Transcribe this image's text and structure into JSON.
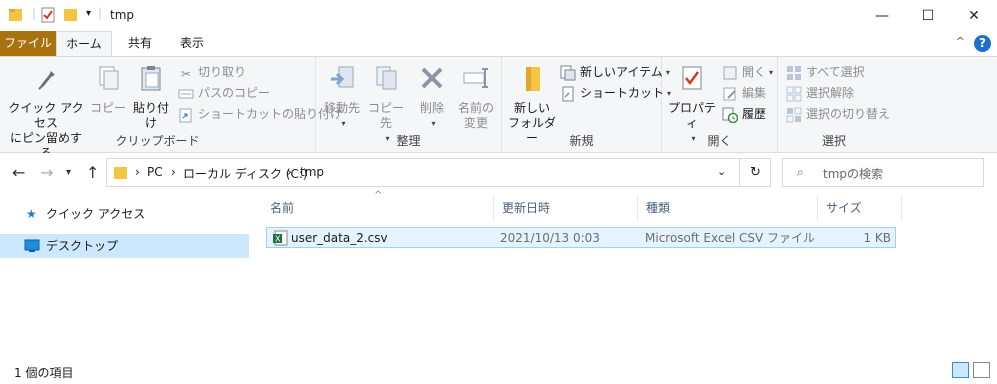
{
  "window": {
    "title": "tmp",
    "controls": {
      "minimize": "—",
      "maximize": "☐",
      "close": "✕"
    }
  },
  "ribbon_tabs": [
    {
      "label": "ファイル"
    },
    {
      "label": "ホーム"
    },
    {
      "label": "共有"
    },
    {
      "label": "表示"
    }
  ],
  "ribbon": {
    "clipboard": {
      "pin_label_1": "クイック アクセス",
      "pin_label_2": "にピン留めする",
      "copy_label": "コピー",
      "paste_label": "貼り付け",
      "cut_label": "切り取り",
      "copy_path_label": "パスのコピー",
      "paste_shortcut_label": "ショートカットの貼り付け",
      "group_label": "クリップボード"
    },
    "organize": {
      "move_to_label": "移動先",
      "copy_to_label": "コピー先",
      "delete_label": "削除",
      "rename_label_1": "名前の",
      "rename_label_2": "変更",
      "group_label": "整理"
    },
    "new": {
      "new_folder_label_1": "新しい",
      "new_folder_label_2": "フォルダー",
      "new_item_label": "新しいアイテム",
      "easy_access_label": "ショートカット",
      "group_label": "新規"
    },
    "open": {
      "properties_label": "プロパティ",
      "open_label": "開く",
      "edit_label": "編集",
      "history_label": "履歴",
      "group_label": "開く"
    },
    "select": {
      "select_all_label": "すべて選択",
      "select_none_label": "選択解除",
      "invert_label": "選択の切り替え",
      "group_label": "選択"
    }
  },
  "address": {
    "crumbs": [
      "PC",
      "ローカル ディスク (C:)",
      "tmp"
    ],
    "search_placeholder": "tmpの検索"
  },
  "nav_pane": [
    {
      "label": "クイック アクセス",
      "selected": false
    },
    {
      "label": "デスクトップ",
      "selected": true
    }
  ],
  "columns": [
    "名前",
    "更新日時",
    "種類",
    "サイズ"
  ],
  "files": [
    {
      "name": "user_data_2.csv",
      "modified": "2021/10/13 0:03",
      "type": "Microsoft Excel CSV ファイル",
      "size": "1 KB"
    }
  ],
  "status": {
    "item_count": "1 個の項目"
  },
  "colors": {
    "file_tab": "#a8720f",
    "selection": "#cce8ff",
    "accent": "#1c6fd1",
    "folder": "#f4c542"
  }
}
